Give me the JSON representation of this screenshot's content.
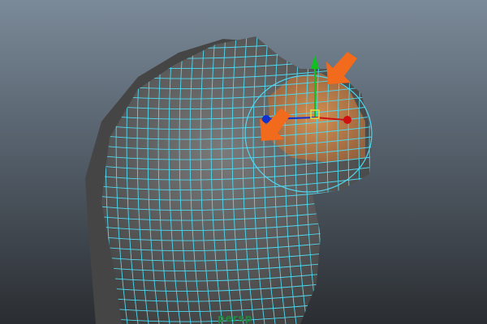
{
  "viewport": {
    "camera_label": "persp",
    "colors": {
      "mesh": "#5f5f5f",
      "wireframe": "#4fd8f0",
      "selection": "#e08a3a",
      "annotation_arrow": "#f26a1b",
      "x_axis": "#d01010",
      "y_axis": "#10c020",
      "z_axis": "#1030d0"
    },
    "annotation_icons": [
      "arrow-down-left-icon",
      "arrow-down-left-icon"
    ]
  }
}
